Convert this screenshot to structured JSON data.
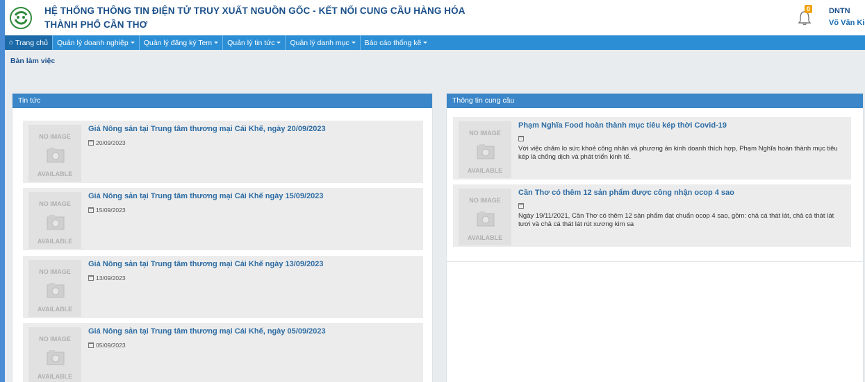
{
  "header": {
    "title_line1": "HỆ THỐNG THÔNG TIN ĐIỆN TỬ TRUY XUẤT NGUỒN GỐC - KẾT NỐI CUNG CẦU HÀNG HÓA",
    "title_line2": "THÀNH PHỐ CẦN THƠ",
    "notification_count": "0",
    "user_role": "DNTN",
    "user_name": "Võ Văn Kiệt"
  },
  "nav": {
    "items": [
      {
        "label": "Trang chủ",
        "icon": "home-icon",
        "active": true
      },
      {
        "label": "Quản lý doanh nghiệp"
      },
      {
        "label": "Quản lý đăng ký Tem"
      },
      {
        "label": "Quản lý tin tức"
      },
      {
        "label": "Quản lý danh mục"
      },
      {
        "label": "Báo cáo thống kê"
      }
    ]
  },
  "breadcrumb": "Bàn làm việc",
  "news_panel": {
    "title": "Tin tức",
    "items": [
      {
        "title": "Giá Nông sản tại Trung tâm thương mại Cái Khế, ngày 20/09/2023",
        "date": "20/09/2023"
      },
      {
        "title": "Giá Nông sản tại Trung tâm thương mại Cái Khế ngày 15/09/2023",
        "date": "15/09/2023"
      },
      {
        "title": "Giá Nông sản tại Trung tâm thương mại Cái Khế ngày 13/09/2023",
        "date": "13/09/2023"
      },
      {
        "title": "Giá Nông sản tại Trung tâm thương mại Cái Khế, ngày 05/09/2023",
        "date": "05/09/2023"
      }
    ]
  },
  "supply_panel": {
    "title": "Thông tin cung cầu",
    "items": [
      {
        "title": "Phạm Nghĩa Food hoàn thành mục tiêu kép thời Covid-19",
        "desc": "Với việc chăm lo sức khoẻ công nhân và phương án kinh doanh thích hợp, Phạm Nghĩa hoàn thành mục tiêu kép là chống dịch và phát triển kinh tế."
      },
      {
        "title": "Cần Thơ có thêm 12 sản phẩm được công nhận ocop 4 sao",
        "desc": "Ngày 19/11/2021, Cần Thơ có thêm 12 sản phẩm đạt chuẩn ocop 4 sao, gồm: chả cá thát lát, chả cá thát lát tươi và chả cá thát lát rút xương kim sa"
      }
    ]
  },
  "thumb": {
    "line1": "NO IMAGE",
    "line2": "AVAILABLE"
  },
  "colors": {
    "brand": "#1a4f8a",
    "nav": "#2c8fd6",
    "panel_head": "#3a86c8",
    "link": "#2e6da4"
  }
}
